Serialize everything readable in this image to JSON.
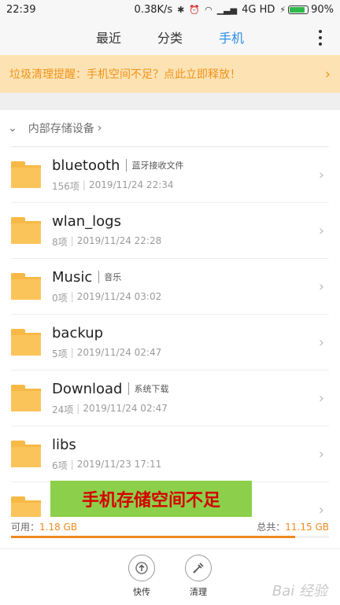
{
  "status_bar": {
    "time": "22:39",
    "speed": "0.38K/s",
    "network": "4G HD",
    "battery": "90%",
    "battery_fill_fraction": 0.9
  },
  "tabs": [
    {
      "label": "最近",
      "active": false
    },
    {
      "label": "分类",
      "active": false
    },
    {
      "label": "手机",
      "active": true
    }
  ],
  "icons": {
    "more": "more-vertical-icon",
    "folder": "folder-icon",
    "chevron": "chevron-right-icon",
    "collapse": "chevron-down-icon",
    "upload": "upload-icon",
    "clean": "brush-icon"
  },
  "banner": {
    "text": "垃圾清理提醒：手机空间不足？点此立即释放！",
    "chevron": "›"
  },
  "breadcrumb": {
    "collapse_symbol": "⌄",
    "label": "内部存储设备",
    "chevron": "›"
  },
  "files": [
    {
      "name": "bluetooth",
      "desc": "蓝牙接收文件",
      "count": "156项",
      "date": "2019/11/24 22:34"
    },
    {
      "name": "wlan_logs",
      "desc": "",
      "count": "8项",
      "date": "2019/11/24 22:28"
    },
    {
      "name": "Music",
      "desc": "音乐",
      "count": "0项",
      "date": "2019/11/24 03:02"
    },
    {
      "name": "backup",
      "desc": "",
      "count": "5项",
      "date": "2019/11/24 02:47"
    },
    {
      "name": "Download",
      "desc": "系统下载",
      "count": "24项",
      "date": "2019/11/24 02:47"
    },
    {
      "name": "libs",
      "desc": "",
      "count": "6项",
      "date": "2019/11/23 17:11"
    },
    {
      "name": "",
      "desc": "",
      "count": "",
      "date": ""
    }
  ],
  "promo_overlay": "手机存储空间不足",
  "storage": {
    "available_label": "可用：",
    "available_value": "1.18 GB",
    "total_label": "总共：",
    "total_value": "11.15 GB",
    "used_fraction": 0.894
  },
  "actions": [
    {
      "label": "快传"
    },
    {
      "label": "清理"
    }
  ],
  "colors": {
    "accent": "#2a8ee8",
    "warning": "#f0931b",
    "folder": "#fbc45a",
    "promo_bg": "#8ccf4a",
    "promo_text": "#d40000"
  },
  "watermark": "Bai 经验"
}
